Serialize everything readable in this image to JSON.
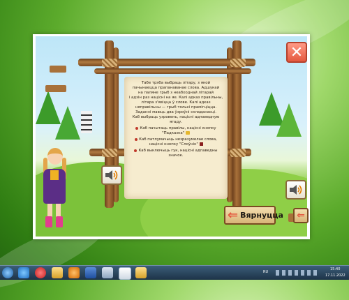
{
  "instructions": {
    "lines": [
      "Табе трэба выбраць літару, з якой",
      "пачынаецца прапанаванае слова. Адшукай",
      "на паляне грыб з неабходнай літарай",
      "і адзін раз націсні на яе. Калі адказ правільны,",
      "літара з'явіцца ў слове. Калі адказ",
      "няправільны — грыб толькі прамігціцца.",
      "Заданні маюць два ўзроўні складанасці.",
      "Каб выбраць узровень, націсні адпаведную ягаду."
    ],
    "bullets": [
      "Каб пачытаць правілы, націсні кнопку \"Падказка\"",
      "Каб патлумачыць незразумелае слова, націсні кнопку \"Слоўнік\"",
      "Каб выключыць гук, націсні адпаведны значок."
    ]
  },
  "buttons": {
    "close": "✕",
    "back_label": "Вярнуцца"
  },
  "tray": {
    "language": "RU",
    "time": "15:40",
    "date": "17.11.2022"
  },
  "icons": {
    "close": "close-icon",
    "back": "arrow-left-icon",
    "speaker": "speaker-icon"
  }
}
